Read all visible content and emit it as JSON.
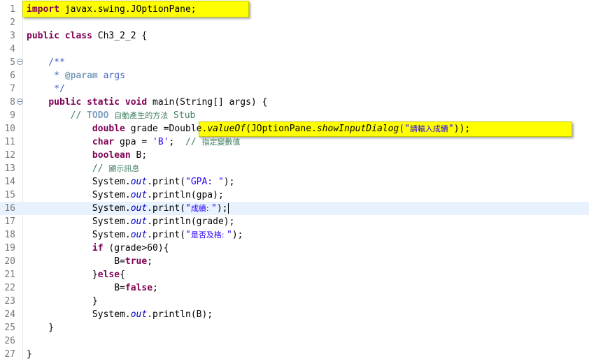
{
  "editor": {
    "current_line": 16,
    "lines": [
      {
        "n": "1",
        "tokens": [
          {
            "t": "import",
            "c": "kw"
          },
          {
            "t": " javax.swing.JOptionPane;",
            "c": ""
          }
        ]
      },
      {
        "n": "2",
        "tokens": []
      },
      {
        "n": "3",
        "tokens": [
          {
            "t": "public",
            "c": "kw"
          },
          {
            "t": " ",
            "c": ""
          },
          {
            "t": "class",
            "c": "kw"
          },
          {
            "t": " Ch3_2_2 {",
            "c": ""
          }
        ]
      },
      {
        "n": "4",
        "tokens": []
      },
      {
        "n": "5",
        "fold": true,
        "tokens": [
          {
            "t": "    /**",
            "c": "jd"
          }
        ]
      },
      {
        "n": "6",
        "tokens": [
          {
            "t": "     * ",
            "c": "jd"
          },
          {
            "t": "@param",
            "c": "jdtag"
          },
          {
            "t": " args",
            "c": "jd"
          }
        ]
      },
      {
        "n": "7",
        "tokens": [
          {
            "t": "     */",
            "c": "jd"
          }
        ]
      },
      {
        "n": "8",
        "fold": true,
        "tokens": [
          {
            "t": "    ",
            "c": ""
          },
          {
            "t": "public",
            "c": "kw"
          },
          {
            "t": " ",
            "c": ""
          },
          {
            "t": "static",
            "c": "kw"
          },
          {
            "t": " ",
            "c": ""
          },
          {
            "t": "void",
            "c": "kw"
          },
          {
            "t": " main(String[] args) {",
            "c": ""
          }
        ]
      },
      {
        "n": "9",
        "tokens": [
          {
            "t": "        // ",
            "c": "cm"
          },
          {
            "t": "TODO",
            "c": "todo"
          },
          {
            "t": " ",
            "c": "cm"
          },
          {
            "t": "自動產生的方法",
            "c": "cm cjk"
          },
          {
            "t": " Stub",
            "c": "cm"
          }
        ]
      },
      {
        "n": "10",
        "tokens": [
          {
            "t": "            ",
            "c": ""
          },
          {
            "t": "double",
            "c": "kw"
          },
          {
            "t": " grade =",
            "c": ""
          },
          {
            "t": "Double.",
            "c": ""
          },
          {
            "t": "valueOf",
            "c": "smeth"
          },
          {
            "t": "(JOptionPane.",
            "c": ""
          },
          {
            "t": "showInputDialog",
            "c": "smeth"
          },
          {
            "t": "(\"",
            "c": "str"
          },
          {
            "t": "請輸入成績",
            "c": "str cjk"
          },
          {
            "t": "\"",
            "c": "str"
          },
          {
            "t": "));",
            "c": ""
          }
        ]
      },
      {
        "n": "11",
        "tokens": [
          {
            "t": "            ",
            "c": ""
          },
          {
            "t": "char",
            "c": "kw"
          },
          {
            "t": " gpa = ",
            "c": ""
          },
          {
            "t": "'B'",
            "c": "str"
          },
          {
            "t": ";  ",
            "c": ""
          },
          {
            "t": "// ",
            "c": "cm"
          },
          {
            "t": "指定變數值",
            "c": "cm cjk"
          }
        ]
      },
      {
        "n": "12",
        "tokens": [
          {
            "t": "            ",
            "c": ""
          },
          {
            "t": "boolean",
            "c": "kw"
          },
          {
            "t": " B;",
            "c": ""
          }
        ]
      },
      {
        "n": "13",
        "tokens": [
          {
            "t": "            // ",
            "c": "cm"
          },
          {
            "t": "顯示訊息",
            "c": "cm cjk"
          }
        ]
      },
      {
        "n": "14",
        "tokens": [
          {
            "t": "            System.",
            "c": ""
          },
          {
            "t": "out",
            "c": "fld"
          },
          {
            "t": ".print(",
            "c": ""
          },
          {
            "t": "\"GPA: \"",
            "c": "str"
          },
          {
            "t": ");",
            "c": ""
          }
        ]
      },
      {
        "n": "15",
        "tokens": [
          {
            "t": "            System.",
            "c": ""
          },
          {
            "t": "out",
            "c": "fld"
          },
          {
            "t": ".println(gpa);",
            "c": ""
          }
        ]
      },
      {
        "n": "16",
        "tokens": [
          {
            "t": "            System.",
            "c": ""
          },
          {
            "t": "out",
            "c": "fld"
          },
          {
            "t": ".print(",
            "c": ""
          },
          {
            "t": "\"",
            "c": "str"
          },
          {
            "t": "成績: ",
            "c": "str cjk"
          },
          {
            "t": "\"",
            "c": "str"
          },
          {
            "t": ");",
            "c": ""
          },
          {
            "t": "",
            "c": "caret"
          }
        ]
      },
      {
        "n": "17",
        "tokens": [
          {
            "t": "            System.",
            "c": ""
          },
          {
            "t": "out",
            "c": "fld"
          },
          {
            "t": ".println(grade);",
            "c": ""
          }
        ]
      },
      {
        "n": "18",
        "tokens": [
          {
            "t": "            System.",
            "c": ""
          },
          {
            "t": "out",
            "c": "fld"
          },
          {
            "t": ".print(",
            "c": ""
          },
          {
            "t": "\"",
            "c": "str"
          },
          {
            "t": "是否及格: ",
            "c": "str cjk"
          },
          {
            "t": "\"",
            "c": "str"
          },
          {
            "t": ");",
            "c": ""
          }
        ]
      },
      {
        "n": "19",
        "tokens": [
          {
            "t": "            ",
            "c": ""
          },
          {
            "t": "if",
            "c": "kw"
          },
          {
            "t": " (grade>60){",
            "c": ""
          }
        ]
      },
      {
        "n": "20",
        "tokens": [
          {
            "t": "                B=",
            "c": ""
          },
          {
            "t": "true",
            "c": "kw"
          },
          {
            "t": ";",
            "c": ""
          }
        ]
      },
      {
        "n": "21",
        "tokens": [
          {
            "t": "            }",
            "c": ""
          },
          {
            "t": "else",
            "c": "kw"
          },
          {
            "t": "{",
            "c": ""
          }
        ]
      },
      {
        "n": "22",
        "tokens": [
          {
            "t": "                B=",
            "c": ""
          },
          {
            "t": "false",
            "c": "kw"
          },
          {
            "t": ";",
            "c": ""
          }
        ]
      },
      {
        "n": "23",
        "tokens": [
          {
            "t": "            }",
            "c": ""
          }
        ]
      },
      {
        "n": "24",
        "tokens": [
          {
            "t": "            System.",
            "c": ""
          },
          {
            "t": "out",
            "c": "fld"
          },
          {
            "t": ".println(B);",
            "c": ""
          }
        ]
      },
      {
        "n": "25",
        "tokens": [
          {
            "t": "    }",
            "c": ""
          }
        ]
      },
      {
        "n": "26",
        "tokens": []
      },
      {
        "n": "27",
        "tokens": [
          {
            "t": "}",
            "c": ""
          }
        ]
      }
    ]
  },
  "colors": {
    "keyword": "#7f0055",
    "string": "#2a00ff",
    "comment": "#3f7f5f",
    "javadoc": "#3f5fbf",
    "static_field": "#0000c0",
    "current_line": "#e8f2fe",
    "highlight": "#ffff00"
  }
}
